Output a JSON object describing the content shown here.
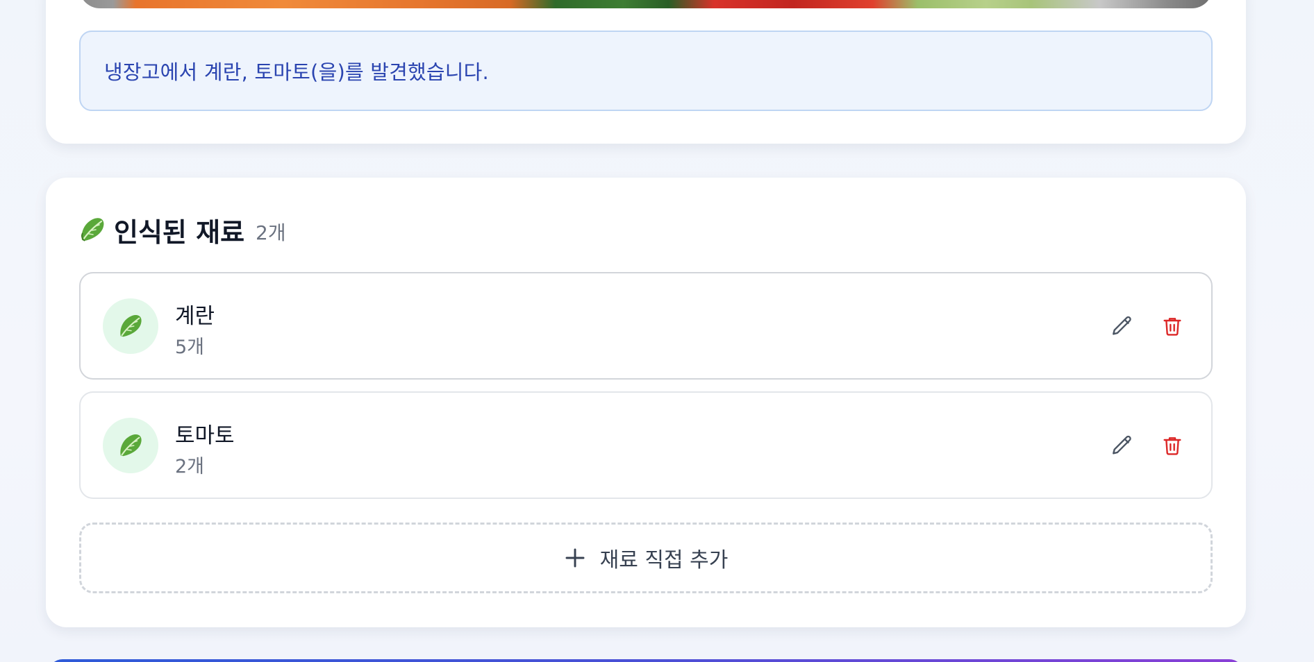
{
  "analysis": {
    "message": "냉장고에서 계란, 토마토(을)를 발견했습니다."
  },
  "ingredients": {
    "section_icon": "leafy-green-icon",
    "title": "인식된 재료",
    "count_label": "2개",
    "items": [
      {
        "name": "계란",
        "quantity": "5개",
        "icon": "leafy-green-icon"
      },
      {
        "name": "토마토",
        "quantity": "2개",
        "icon": "leafy-green-icon"
      }
    ],
    "add_label": "재료 직접 추가"
  },
  "colors": {
    "notice_bg": "#eef4fd",
    "notice_text": "#2a44b0",
    "delete": "#dc2626",
    "avatar_bg": "#e3f8ea"
  }
}
